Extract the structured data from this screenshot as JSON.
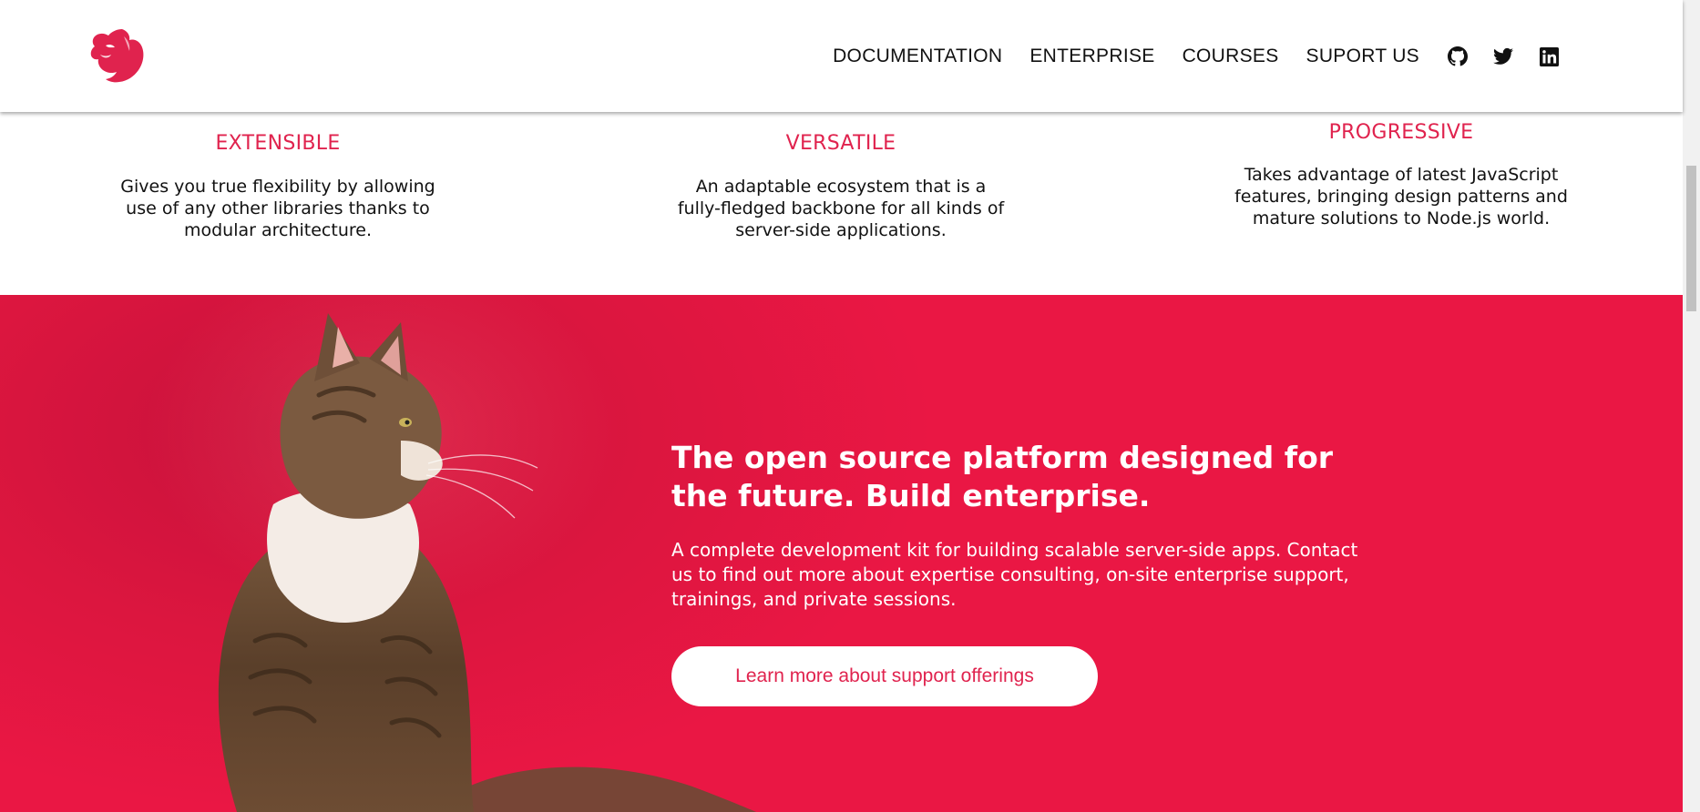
{
  "header": {
    "logo_name": "nestjs-logo",
    "nav": [
      {
        "label": "DOCUMENTATION"
      },
      {
        "label": "ENTERPRISE"
      },
      {
        "label": "COURSES"
      },
      {
        "label": "SUPORT US"
      }
    ],
    "social_icons": [
      "github-icon",
      "twitter-icon",
      "linkedin-icon"
    ]
  },
  "features": [
    {
      "title": "EXTENSIBLE",
      "text": "Gives you true flexibility by allowing use of any other libraries thanks to modular architecture."
    },
    {
      "title": "VERSATILE",
      "text": "An adaptable ecosystem that is a fully-fledged backbone for all kinds of server-side applications."
    },
    {
      "title": "PROGRESSIVE",
      "text": "Takes advantage of latest JavaScript features, bringing design patterns and mature solutions to Node.js world."
    }
  ],
  "hero": {
    "title": "The open source platform designed for the future. Build enterprise.",
    "text": "A complete development kit for building scalable server-side apps. Contact us to find out more about expertise consulting, on-site enterprise support, trainings, and private sessions.",
    "button_label": "Learn more about support offerings"
  },
  "colors": {
    "brand": "#e0234e",
    "hero_bg": "#ea1744",
    "text": "#111111"
  }
}
